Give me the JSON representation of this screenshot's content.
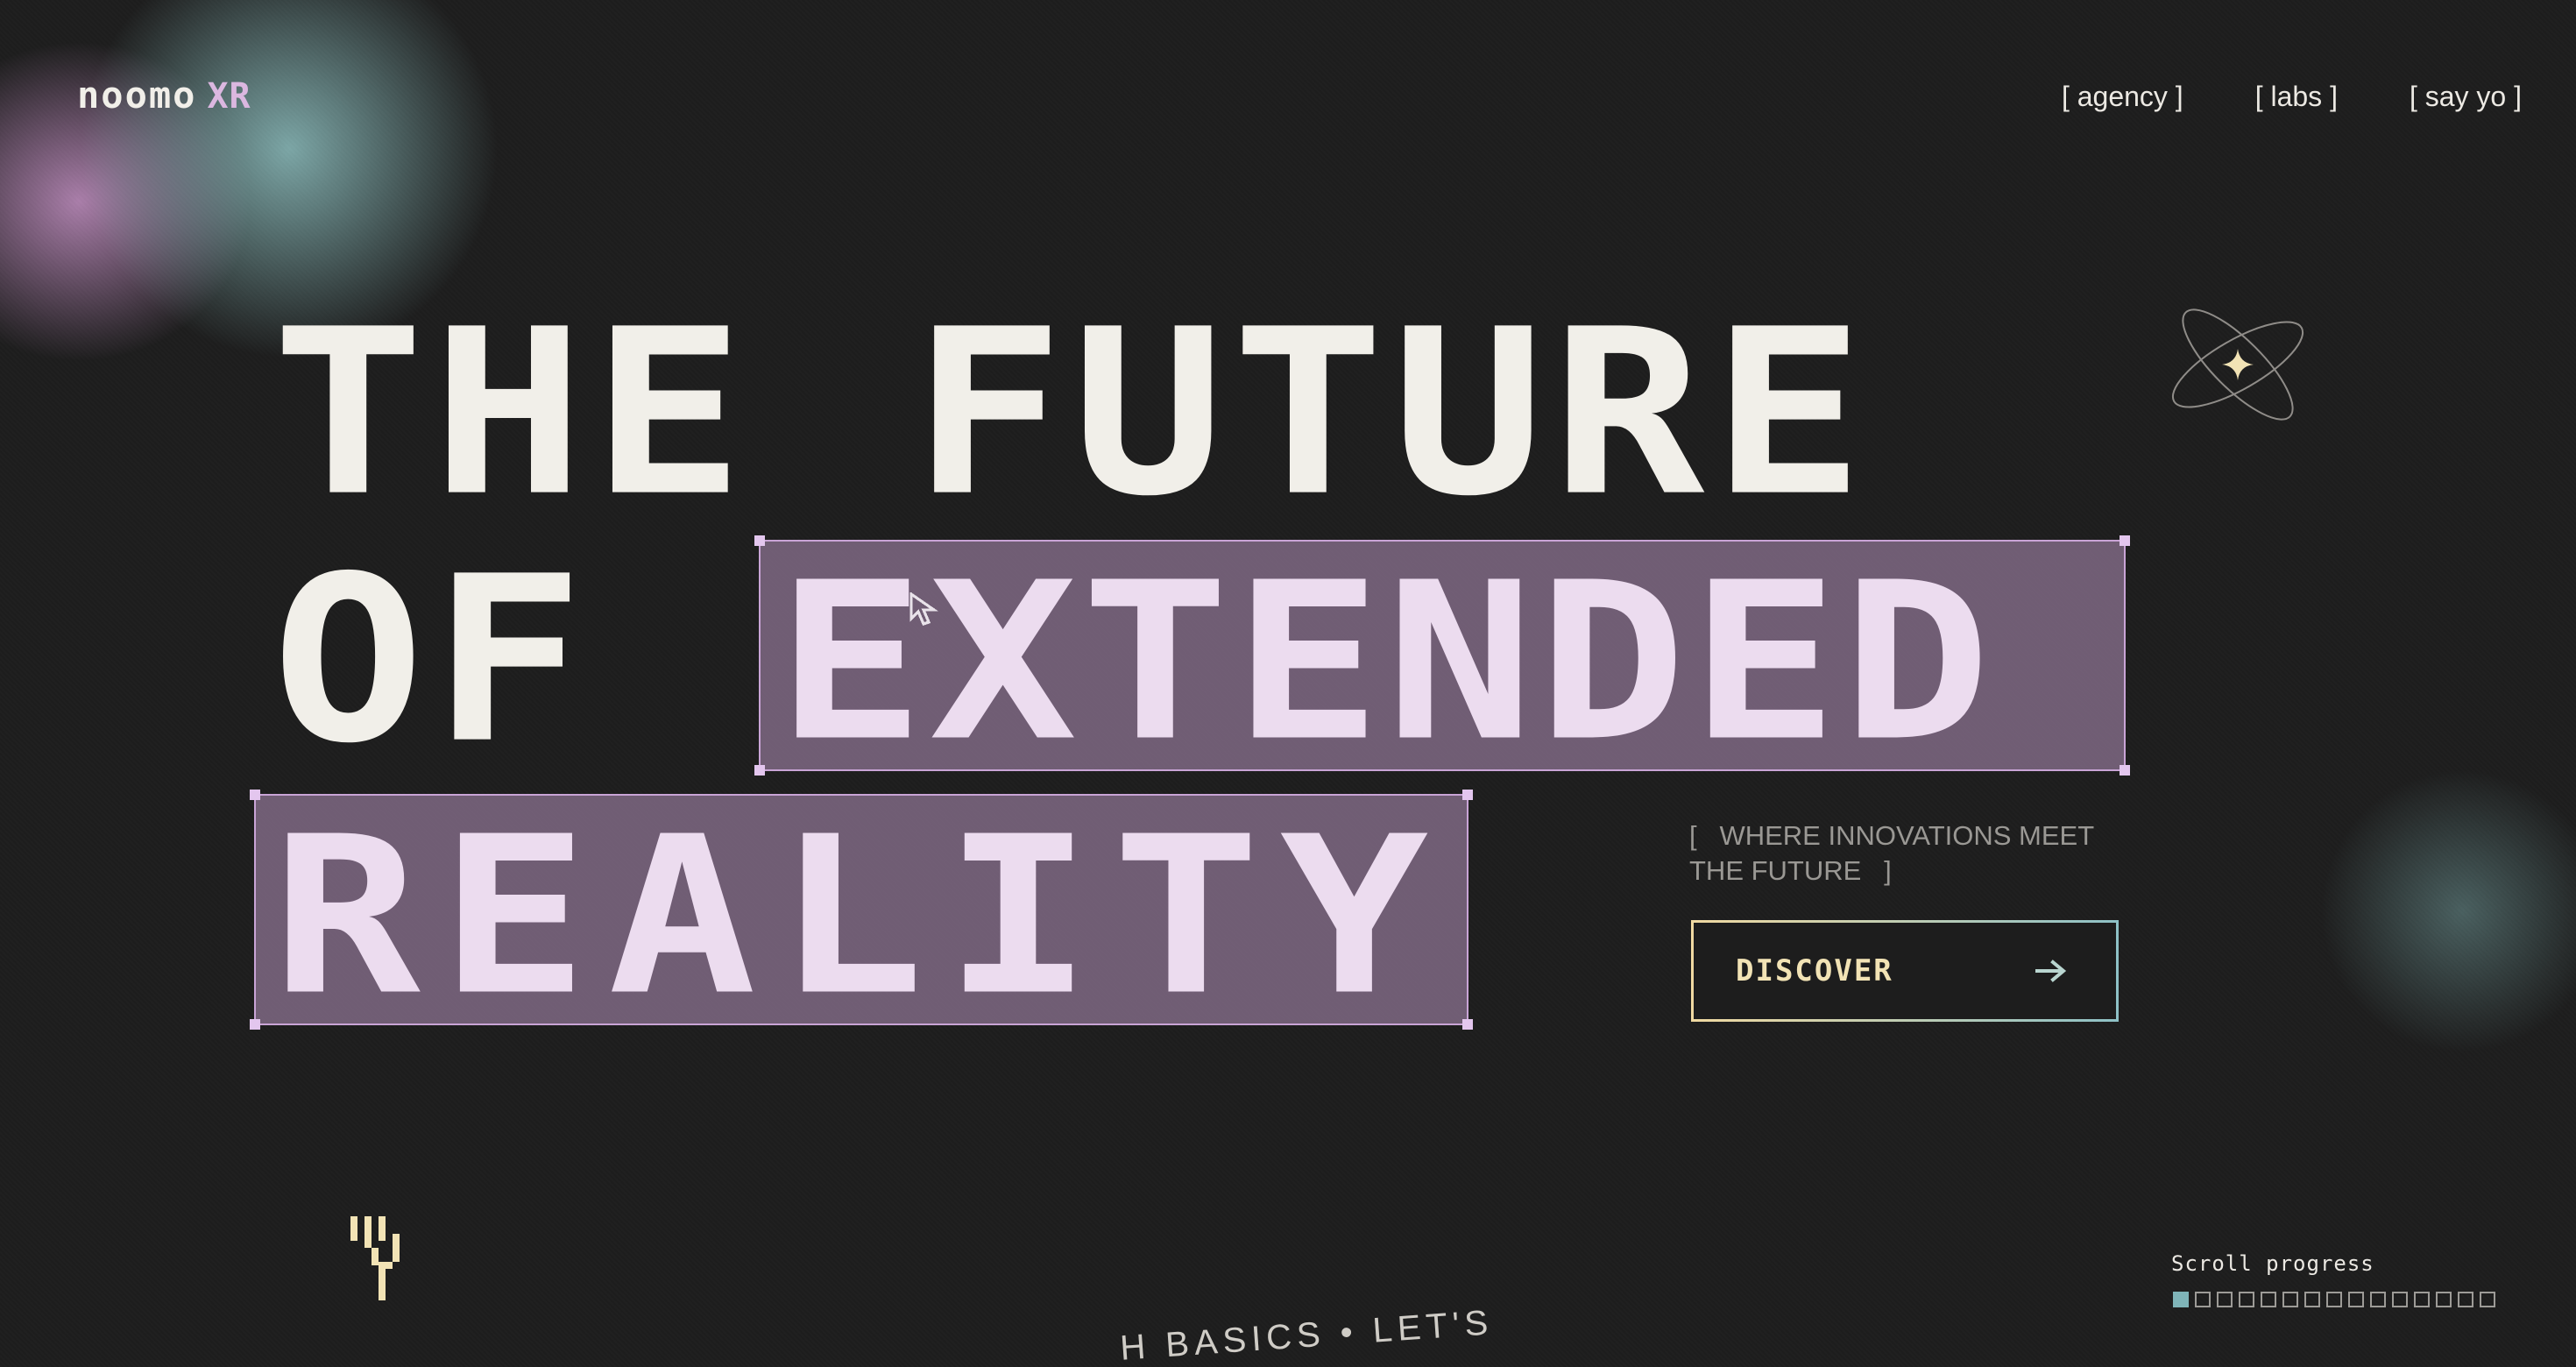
{
  "brand": {
    "name": "noomo",
    "suffix": "XR"
  },
  "nav": {
    "items": [
      {
        "label": "[ agency ]"
      },
      {
        "label": "[ labs ]"
      },
      {
        "label": "[ say yo ]"
      }
    ]
  },
  "hero": {
    "line1": "THE FUTURE",
    "line2_plain": "OF ",
    "line2_highlight": "EXTENDED",
    "line3_highlight": "REALITY"
  },
  "tagline": "[   WHERE INNOVATIONS MEET\nTHE FUTURE   ]",
  "cta": {
    "label": "DISCOVER",
    "icon": "arrow-right-icon"
  },
  "scroll": {
    "label": "Scroll progress",
    "total_steps": 15,
    "current_step": 1
  },
  "circular_text": "H BASICS • LET'S",
  "colors": {
    "background": "#1d1d1d",
    "text": "#f1efe9",
    "accent_lilac": "#dbb7e0",
    "highlight_fill": "#8c7391",
    "cta_gold": "#f2e3b5",
    "accent_teal": "#7fb4b8"
  }
}
